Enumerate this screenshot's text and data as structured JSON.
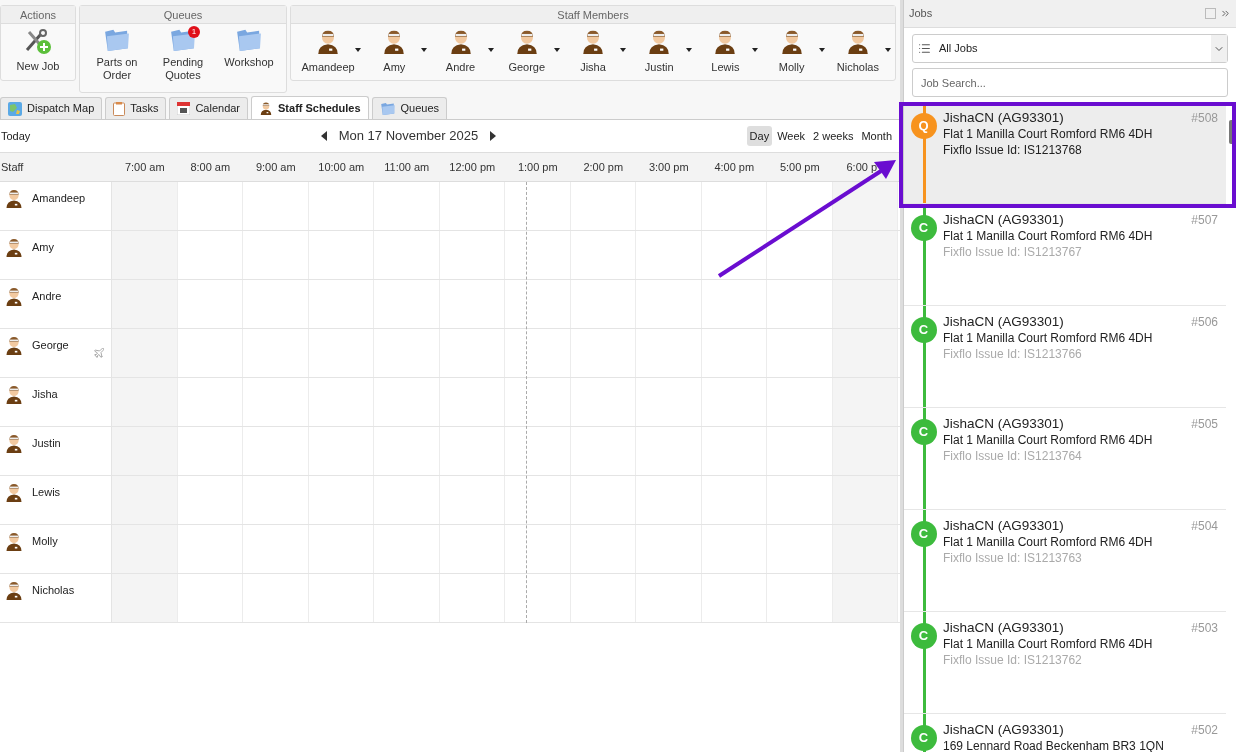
{
  "toolbar": {
    "groups": [
      {
        "title": "Actions",
        "kind": "actions",
        "items": [
          {
            "label": "New Job"
          }
        ]
      },
      {
        "title": "Queues",
        "kind": "queues",
        "items": [
          {
            "label": "Parts on Order"
          },
          {
            "label": "Pending Quotes",
            "badge": "1"
          },
          {
            "label": "Workshop"
          }
        ]
      },
      {
        "title": "Staff Members",
        "kind": "staff",
        "items": [
          {
            "label": "Amandeep"
          },
          {
            "label": "Amy"
          },
          {
            "label": "Andre"
          },
          {
            "label": "George"
          },
          {
            "label": "Jisha"
          },
          {
            "label": "Justin"
          },
          {
            "label": "Lewis"
          },
          {
            "label": "Molly"
          },
          {
            "label": "Nicholas"
          }
        ]
      }
    ]
  },
  "tabs": [
    {
      "label": "Dispatch Map",
      "kind": "map",
      "selected": false
    },
    {
      "label": "Tasks",
      "kind": "tasks",
      "selected": false
    },
    {
      "label": "Calendar",
      "kind": "calendar",
      "selected": false
    },
    {
      "label": "Staff Schedules",
      "kind": "staff",
      "selected": true
    },
    {
      "label": "Queues",
      "kind": "folder",
      "selected": false
    }
  ],
  "schedule": {
    "today": "Today",
    "date": "Mon 17 November 2025",
    "views": [
      {
        "label": "Day",
        "selected": true
      },
      {
        "label": "Week",
        "selected": false
      },
      {
        "label": "2 weeks",
        "selected": false
      },
      {
        "label": "Month",
        "selected": false
      }
    ],
    "staff_heading": "Staff",
    "hours": [
      "7:00 am",
      "8:00 am",
      "9:00 am",
      "10:00 am",
      "11:00 am",
      "12:00 pm",
      "1:00 pm",
      "2:00 pm",
      "3:00 pm",
      "4:00 pm",
      "5:00 pm",
      "6:00 p"
    ],
    "rows": [
      {
        "name": "Amandeep",
        "away": false
      },
      {
        "name": "Amy",
        "away": false
      },
      {
        "name": "Andre",
        "away": false
      },
      {
        "name": "George",
        "away": true
      },
      {
        "name": "Jisha",
        "away": false
      },
      {
        "name": "Justin",
        "away": false
      },
      {
        "name": "Lewis",
        "away": false
      },
      {
        "name": "Molly",
        "away": false
      },
      {
        "name": "Nicholas",
        "away": false
      }
    ]
  },
  "jobs_panel": {
    "title": "Jobs",
    "filter": "All Jobs",
    "search": {
      "placeholder": "Job Search..."
    },
    "jobs": [
      {
        "status": "Q",
        "color": "#f7931e",
        "title": "JishaCN (AG93301)",
        "number": "#508",
        "address": "Flat 1 Manilla Court Romford RM6 4DH",
        "issue": "Fixflo Issue Id: IS1213768",
        "selected": true
      },
      {
        "status": "C",
        "color": "#3dbb3d",
        "title": "JishaCN (AG93301)",
        "number": "#507",
        "address": "Flat 1 Manilla Court Romford RM6 4DH",
        "issue": "Fixflo Issue Id: IS1213767",
        "selected": false
      },
      {
        "status": "C",
        "color": "#3dbb3d",
        "title": "JishaCN (AG93301)",
        "number": "#506",
        "address": "Flat 1 Manilla Court Romford RM6 4DH",
        "issue": "Fixflo Issue Id: IS1213766",
        "selected": false
      },
      {
        "status": "C",
        "color": "#3dbb3d",
        "title": "JishaCN (AG93301)",
        "number": "#505",
        "address": "Flat 1 Manilla Court Romford RM6 4DH",
        "issue": "Fixflo Issue Id: IS1213764",
        "selected": false
      },
      {
        "status": "C",
        "color": "#3dbb3d",
        "title": "JishaCN (AG93301)",
        "number": "#504",
        "address": "Flat 1 Manilla Court Romford RM6 4DH",
        "issue": "Fixflo Issue Id: IS1213763",
        "selected": false
      },
      {
        "status": "C",
        "color": "#3dbb3d",
        "title": "JishaCN (AG93301)",
        "number": "#503",
        "address": "Flat 1 Manilla Court Romford RM6 4DH",
        "issue": "Fixflo Issue Id: IS1213762",
        "selected": false
      },
      {
        "status": "C",
        "color": "#3dbb3d",
        "title": "JishaCN (AG93301)",
        "number": "#502",
        "address": "169 Lennard Road Beckenham BR3 1QN",
        "selected": false
      }
    ]
  }
}
